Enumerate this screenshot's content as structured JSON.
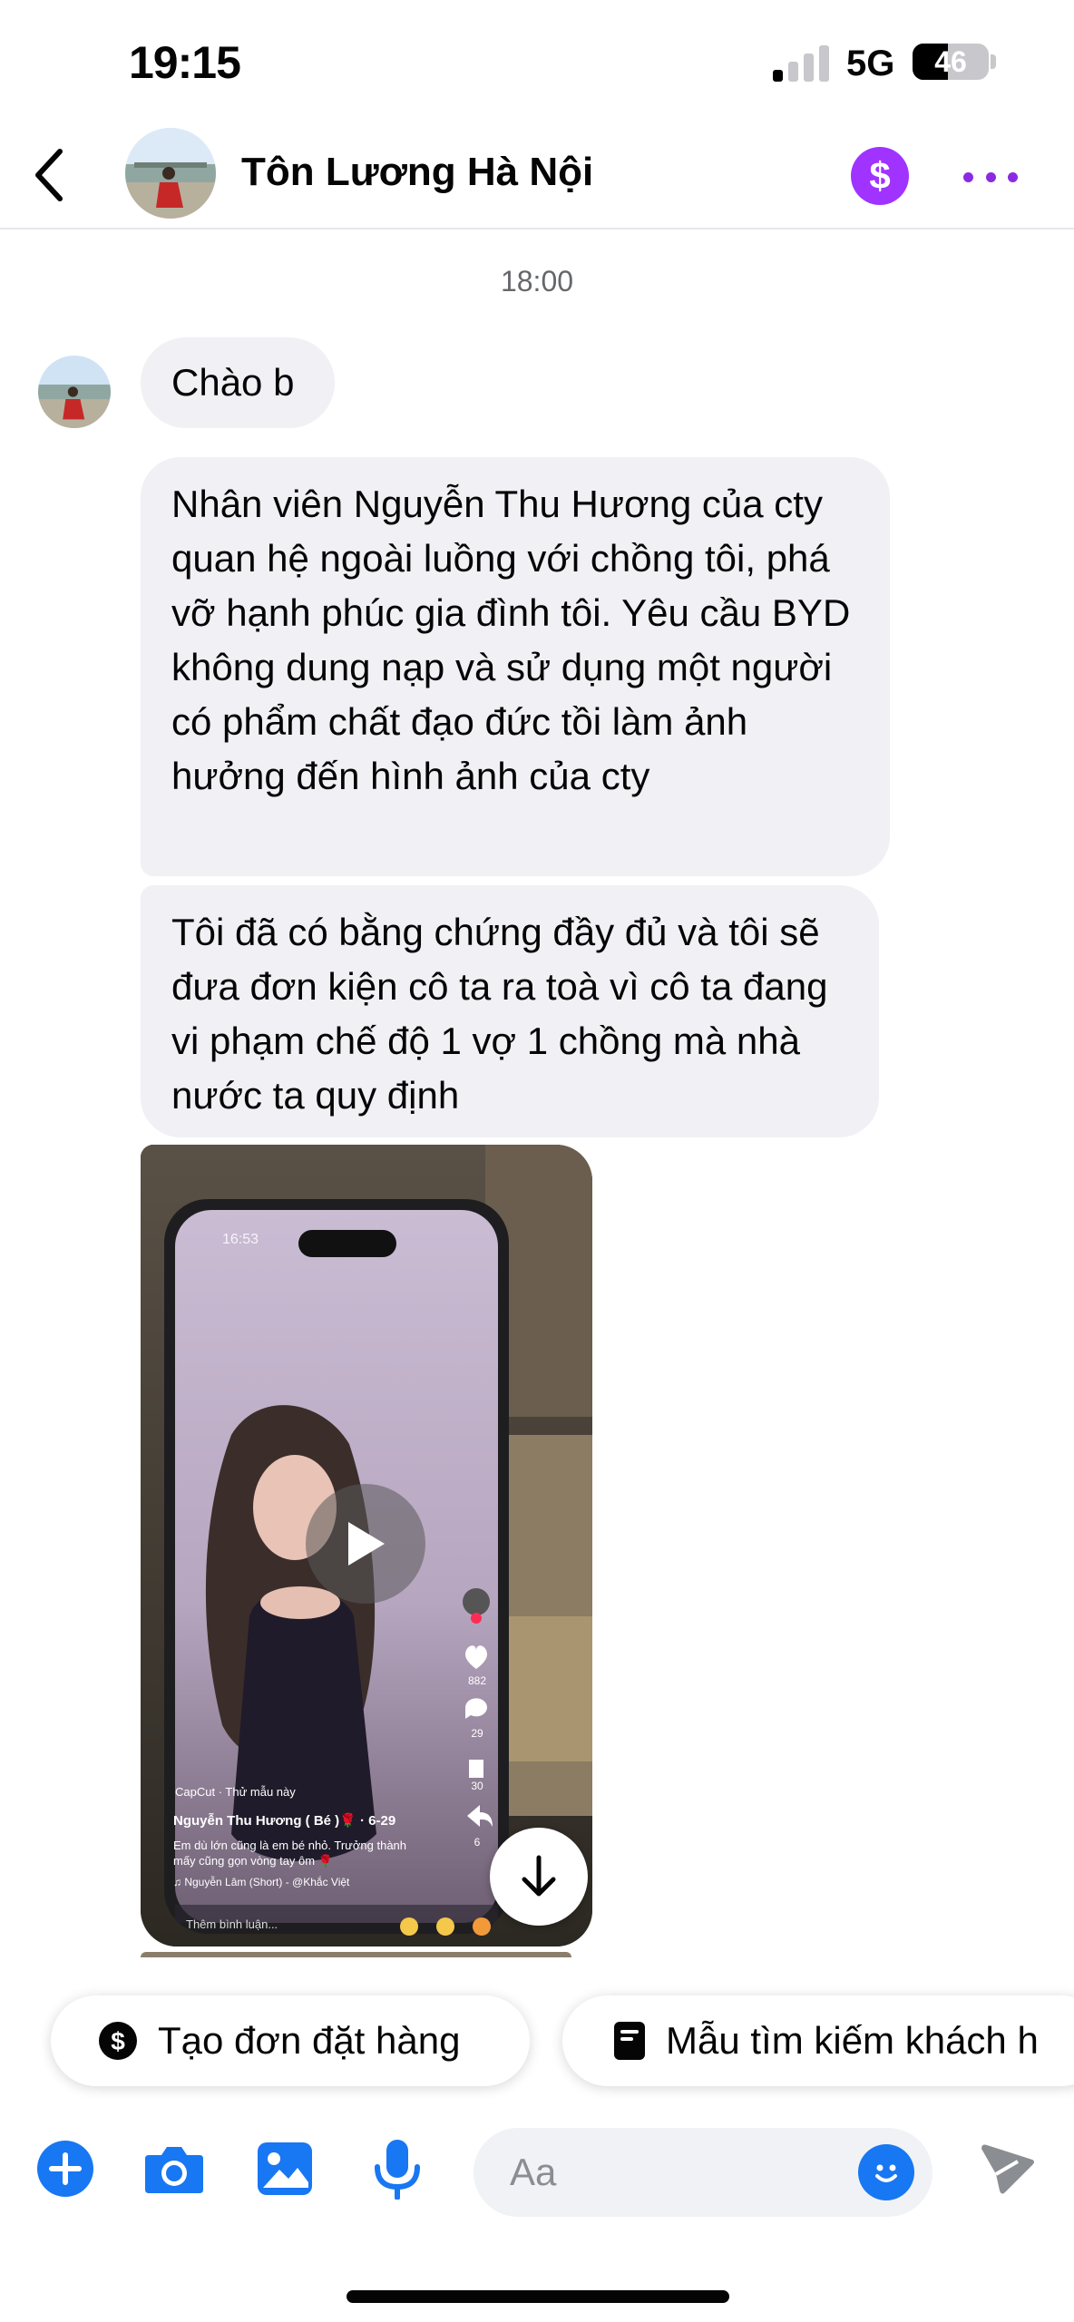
{
  "status_bar": {
    "time": "19:15",
    "network": "5G",
    "battery": "46",
    "battery_level": 0.46,
    "signal_bars_active": 1
  },
  "header": {
    "contact_name": "Tôn Lương Hà Nội",
    "pay_symbol": "$"
  },
  "chat": {
    "timestamp": "18:00",
    "messages": [
      {
        "text": "Chào b"
      },
      {
        "text": "Nhân viên Nguyễn Thu Hương của cty quan hệ ngoài luồng với chồng tôi, phá vỡ hạnh phúc gia đình tôi. Yêu cầu BYD không dung nạp và sử dụng một người có phẩm chất đạo đức tồi làm ảnh hưởng đến hình ảnh của cty"
      },
      {
        "text": "Tôi đã có bằng chứng đầy đủ và tôi sẽ đưa đơn kiện cô ta ra toà vì cô ta đang vi phạm chế độ 1 vợ 1 chồng mà nhà nước ta quy định"
      }
    ],
    "video": {
      "phone_time": "16:53",
      "brand": "CapCut · Thử mẫu này",
      "title": "Nguyễn Thu Hương ( Bé )🌹 · 6-29",
      "caption": "Em dù lớn cũng là em bé nhỏ. Trưởng thành mấy cũng gọn vòng tay ôm 🌹",
      "music": "♫ Nguyễn Lâm (Short) - @Khắc Việt",
      "comment_placeholder": "Thêm bình luận...",
      "likes": "882",
      "comments": "29",
      "saves": "30",
      "shares": "6"
    }
  },
  "quick_replies": [
    {
      "label": "Tạo đơn đặt hàng",
      "icon": "dollar-circle-icon"
    },
    {
      "label": "Mẫu tìm kiếm khách h",
      "icon": "form-icon"
    }
  ],
  "composer": {
    "placeholder": "Aa"
  },
  "colors": {
    "accent": "#1877f2",
    "pay": "#a033ff",
    "more": "#8a2be2",
    "bubble": "#f0f0f5"
  }
}
